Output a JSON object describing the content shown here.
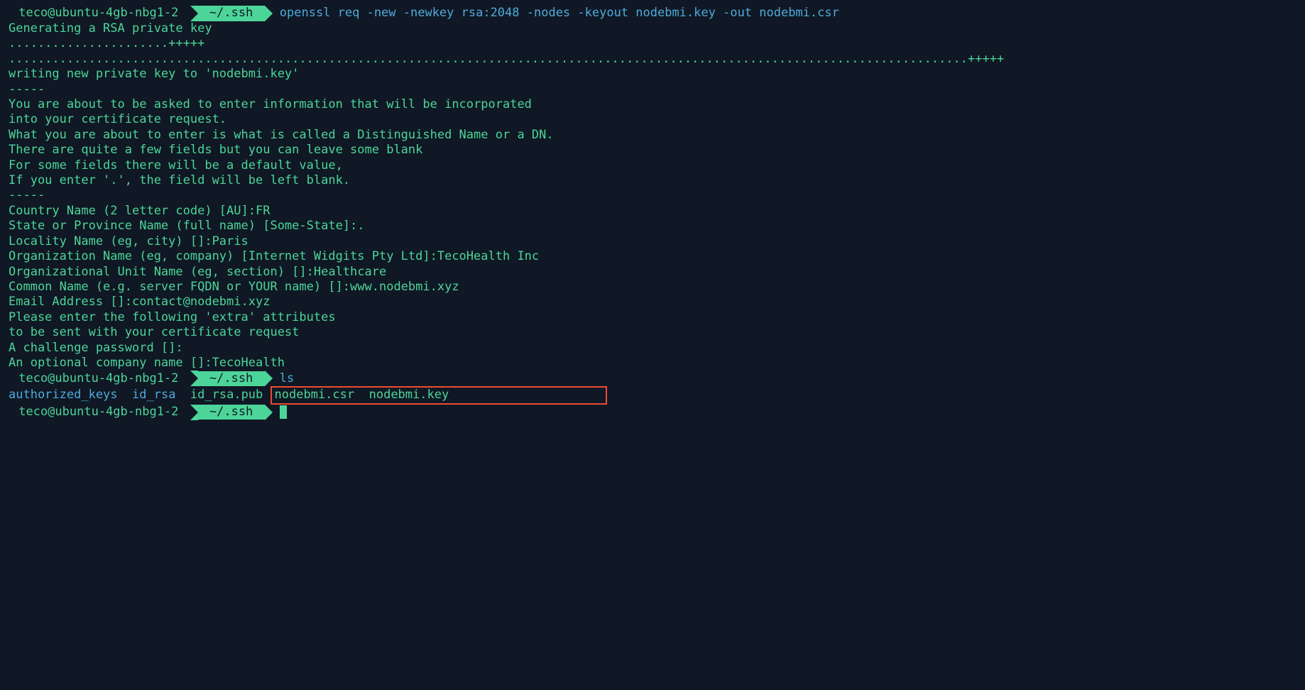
{
  "prompt1": {
    "user_host": " teco@ubuntu-4gb-nbg1-2 ",
    "path": " ~/.ssh ",
    "command": " openssl req -new -newkey rsa:2048 -nodes -keyout nodebmi.key -out nodebmi.csr"
  },
  "out": {
    "l1": "Generating a RSA private key",
    "l2": "......................+++++",
    "l3": "....................................................................................................................................+++++",
    "l4": "writing new private key to 'nodebmi.key'",
    "l5": "-----",
    "l6": "You are about to be asked to enter information that will be incorporated",
    "l7": "into your certificate request.",
    "l8": "What you are about to enter is what is called a Distinguished Name or a DN.",
    "l9": "There are quite a few fields but you can leave some blank",
    "l10": "For some fields there will be a default value,",
    "l11": "If you enter '.', the field will be left blank.",
    "l12": "-----",
    "l13": "Country Name (2 letter code) [AU]:FR",
    "l14": "State or Province Name (full name) [Some-State]:.",
    "l15": "Locality Name (eg, city) []:Paris",
    "l16": "Organization Name (eg, company) [Internet Widgits Pty Ltd]:TecoHealth Inc",
    "l17": "Organizational Unit Name (eg, section) []:Healthcare",
    "l18": "Common Name (e.g. server FQDN or YOUR name) []:www.nodebmi.xyz",
    "l19": "Email Address []:contact@nodebmi.xyz",
    "l20": "",
    "l21": "Please enter the following 'extra' attributes",
    "l22": "to be sent with your certificate request",
    "l23": "A challenge password []:",
    "l24": "An optional company name []:TecoHealth"
  },
  "prompt2": {
    "user_host": " teco@ubuntu-4gb-nbg1-2 ",
    "path": " ~/.ssh ",
    "command": " ls"
  },
  "ls": {
    "f1": "authorized_keys",
    "f2": "id_rsa",
    "f3": "id_rsa.pub",
    "f4": "nodebmi.csr",
    "f5": "nodebmi.key"
  },
  "prompt3": {
    "user_host": " teco@ubuntu-4gb-nbg1-2 ",
    "path": " ~/.ssh "
  }
}
